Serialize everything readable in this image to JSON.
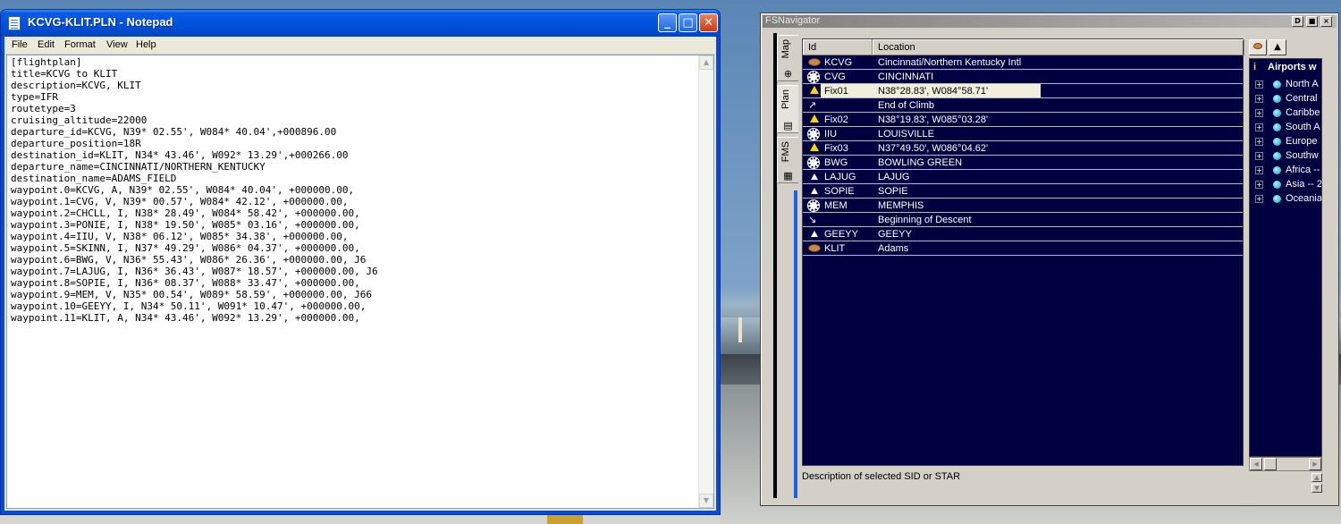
{
  "notepad": {
    "title": "KCVG-KLIT.PLN - Notepad",
    "menu": [
      "File",
      "Edit",
      "Format",
      "View",
      "Help"
    ],
    "lines": [
      "[flightplan]",
      "title=KCVG to KLIT",
      "description=KCVG, KLIT",
      "type=IFR",
      "routetype=3",
      "cruising_altitude=22000",
      "departure_id=KCVG, N39* 02.55', W084* 40.04',+000896.00",
      "departure_position=18R",
      "destination_id=KLIT, N34* 43.46', W092* 13.29',+000266.00",
      "departure_name=CINCINNATI/NORTHERN_KENTUCKY",
      "destination_name=ADAMS_FIELD",
      "waypoint.0=KCVG, A, N39* 02.55', W084* 40.04', +000000.00,",
      "waypoint.1=CVG, V, N39* 00.57', W084* 42.12', +000000.00,",
      "waypoint.2=CHCLL, I, N38* 28.49', W084* 58.42', +000000.00,",
      "waypoint.3=PONIE, I, N38* 19.50', W085* 03.16', +000000.00,",
      "waypoint.4=IIU, V, N38* 06.12', W085* 34.38', +000000.00,",
      "waypoint.5=SKINN, I, N37* 49.29', W086* 04.37', +000000.00,",
      "waypoint.6=BWG, V, N36* 55.43', W086* 26.36', +000000.00, J6",
      "waypoint.7=LAJUG, I, N36* 36.43', W087* 18.57', +000000.00, J6",
      "waypoint.8=SOPIE, I, N36* 08.37', W088* 33.47', +000000.00,",
      "waypoint.9=MEM, V, N35* 00.54', W089* 58.59', +000000.00, J66",
      "waypoint.10=GEEYY, I, N34* 50.11', W091* 10.47', +000000.00,",
      "waypoint.11=KLIT, A, N34* 43.46', W092* 13.29', +000000.00,"
    ]
  },
  "fsnav": {
    "title": "FSNavigator",
    "title_buttons": [
      "D",
      "■",
      "×"
    ],
    "tabs": [
      "Map",
      "Plan",
      "FMS"
    ],
    "columns": {
      "id": "Id",
      "location": "Location"
    },
    "rows": [
      {
        "id": "KCVG",
        "location": "Cincinnati/Northern Kentucky Intl",
        "icon": "airport"
      },
      {
        "id": "CVG",
        "location": "CINCINNATI",
        "icon": "vor"
      },
      {
        "id": "Fix01",
        "location": "N38°28.83', W084°58.71'",
        "icon": "fix"
      },
      {
        "id": "",
        "location": "End of Climb",
        "icon": "climb"
      },
      {
        "id": "Fix02",
        "location": "N38°19.83', W085°03.28'",
        "icon": "fix"
      },
      {
        "id": "IIU",
        "location": "LOUISVILLE",
        "icon": "vor"
      },
      {
        "id": "Fix03",
        "location": "N37°49.50', W086°04.62'",
        "icon": "fix"
      },
      {
        "id": "BWG",
        "location": "BOWLING GREEN",
        "icon": "vor"
      },
      {
        "id": "LAJUG",
        "location": "LAJUG",
        "icon": "intersection"
      },
      {
        "id": "SOPIE",
        "location": "SOPIE",
        "icon": "intersection"
      },
      {
        "id": "MEM",
        "location": "MEMPHIS",
        "icon": "vor"
      },
      {
        "id": "",
        "location": "Beginning of Descent",
        "icon": "descent"
      },
      {
        "id": "GEEYY",
        "location": "GEEYY",
        "icon": "intersection"
      },
      {
        "id": "KLIT",
        "location": "Adams",
        "icon": "airport"
      }
    ],
    "selected_row": "Fix01",
    "description": "Description of selected SID or STAR",
    "airports": {
      "header": "Airports w",
      "items": [
        "North A",
        "Central",
        "Caribbe",
        "South A",
        "Europe",
        "Southw",
        "Africa -- 2",
        "Asia -- 2",
        "Oceania"
      ]
    }
  }
}
